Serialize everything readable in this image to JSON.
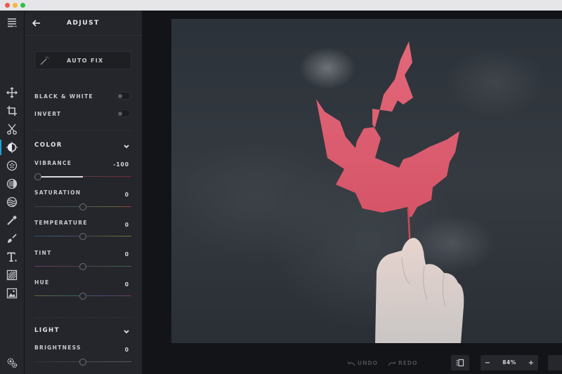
{
  "window": {
    "controls": [
      "close",
      "minimize",
      "maximize"
    ]
  },
  "toolrail": {
    "menu_icon": "hamburger-menu-icon",
    "tools": [
      {
        "name": "move",
        "icon": "move-arrows-icon",
        "active": false
      },
      {
        "name": "crop",
        "icon": "crop-icon",
        "active": false
      },
      {
        "name": "cut",
        "icon": "scissors-icon",
        "active": false
      },
      {
        "name": "adjust",
        "icon": "adjust-contrast-icon",
        "active": true
      },
      {
        "name": "filters",
        "icon": "filter-dots-icon",
        "active": false
      },
      {
        "name": "effects",
        "icon": "effects-circle-icon",
        "active": false
      },
      {
        "name": "waves",
        "icon": "waves-icon",
        "active": false
      },
      {
        "name": "retouch",
        "icon": "wand-brush-icon",
        "active": false
      },
      {
        "name": "draw",
        "icon": "paintbrush-icon",
        "active": false
      },
      {
        "name": "text",
        "icon": "text-icon",
        "active": false
      },
      {
        "name": "texture",
        "icon": "texture-hatch-icon",
        "active": false
      },
      {
        "name": "image",
        "icon": "image-icon",
        "active": false
      }
    ],
    "settings_icon": "settings-gears-icon",
    "accent": "#1fa3d6"
  },
  "panel": {
    "title": "ADJUST",
    "auto_fix_label": "AUTO FIX",
    "toggles": [
      {
        "label": "BLACK & WHITE",
        "on": false
      },
      {
        "label": "INVERT",
        "on": false
      }
    ],
    "sections": [
      {
        "title": "COLOR",
        "expanded": true,
        "sliders": [
          {
            "label": "VIBRANCE",
            "value": "-100",
            "min": -100,
            "max": 100,
            "current": -100
          },
          {
            "label": "SATURATION",
            "value": "0",
            "min": -100,
            "max": 100,
            "current": 0
          },
          {
            "label": "TEMPERATURE",
            "value": "0",
            "min": -100,
            "max": 100,
            "current": 0
          },
          {
            "label": "TINT",
            "value": "0",
            "min": -100,
            "max": 100,
            "current": 0
          },
          {
            "label": "HUE",
            "value": "0",
            "min": -100,
            "max": 100,
            "current": 0
          }
        ]
      },
      {
        "title": "LIGHT",
        "expanded": true,
        "sliders": [
          {
            "label": "BRIGHTNESS",
            "value": "0",
            "min": -100,
            "max": 100,
            "current": 0
          }
        ]
      }
    ]
  },
  "bottombar": {
    "undo_label": "UNDO",
    "redo_label": "REDO",
    "zoom_value": "84%",
    "zoom_minus": "−",
    "zoom_plus": "+"
  }
}
